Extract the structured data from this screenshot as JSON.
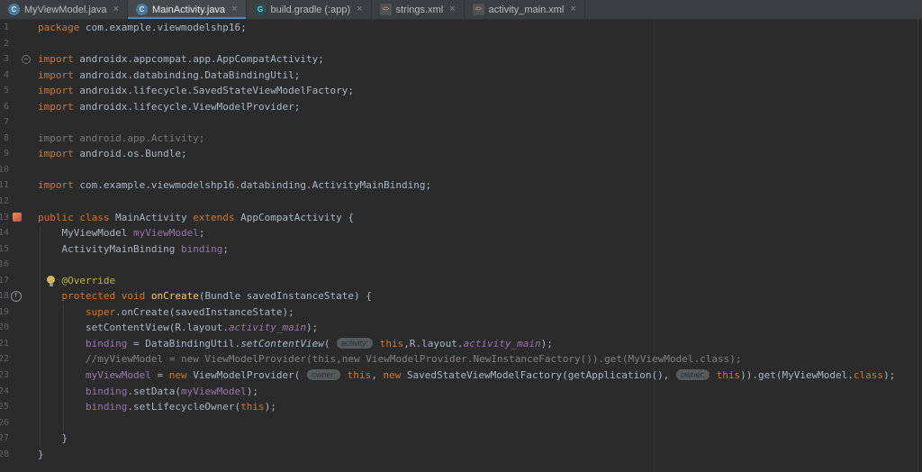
{
  "colors": {
    "editor_bg": "#2b2b2b",
    "tab_bar_bg": "#3c3f41",
    "active_tab_underline": "#4a88c7",
    "keyword": "#cc7832",
    "text": "#a9b7c6",
    "field": "#9876aa",
    "method_decl": "#ffc66b",
    "annotation": "#bbb529",
    "comment": "#808080",
    "line_number": "#606366",
    "hint_bg": "#555a5c",
    "hint_text": "#2d3133"
  },
  "icons": {
    "java-class": "C",
    "gradle": "G",
    "xml": "<>"
  },
  "tab_bar": {
    "close_glyph": "×",
    "tabs": [
      {
        "label": "MyViewModel.java",
        "icon": "java-class",
        "active": false
      },
      {
        "label": "MainActivity.java",
        "icon": "java-class",
        "active": true
      },
      {
        "label": "build.gradle (:app)",
        "icon": "gradle",
        "active": false
      },
      {
        "label": "strings.xml",
        "icon": "xml",
        "active": false
      },
      {
        "label": "activity_main.xml",
        "icon": "xml",
        "active": false
      }
    ]
  },
  "editor": {
    "lines": [
      {
        "n": 1,
        "tokens": [
          [
            "kw",
            "package "
          ],
          [
            "txt",
            "com.example.viewmodelshp16;"
          ]
        ]
      },
      {
        "n": 2,
        "tokens": []
      },
      {
        "n": 3,
        "gutter": "fold",
        "tokens": [
          [
            "kw",
            "import "
          ],
          [
            "txt",
            "androidx.appcompat.app.AppCompatActivity;"
          ]
        ]
      },
      {
        "n": 4,
        "tokens": [
          [
            "kw",
            "import "
          ],
          [
            "txt",
            "androidx.databinding.DataBindingUtil;"
          ]
        ]
      },
      {
        "n": 5,
        "tokens": [
          [
            "kw",
            "import "
          ],
          [
            "txt",
            "androidx.lifecycle.SavedStateViewModelFactory;"
          ]
        ]
      },
      {
        "n": 6,
        "tokens": [
          [
            "kw",
            "import "
          ],
          [
            "txt",
            "androidx.lifecycle.ViewModelProvider;"
          ]
        ]
      },
      {
        "n": 7,
        "tokens": []
      },
      {
        "n": 8,
        "tokens": [
          [
            "gray",
            "import android.app.Activity;"
          ]
        ]
      },
      {
        "n": 9,
        "tokens": [
          [
            "kw",
            "import "
          ],
          [
            "txt",
            "android.os.Bundle;"
          ]
        ]
      },
      {
        "n": 10,
        "tokens": []
      },
      {
        "n": 11,
        "tokens": [
          [
            "kw",
            "import "
          ],
          [
            "txt",
            "com.example.viewmodelshp16.databinding.ActivityMainBinding;"
          ]
        ]
      },
      {
        "n": 12,
        "tokens": []
      },
      {
        "n": 13,
        "gutter": "cls",
        "tokens": [
          [
            "kw",
            "public class "
          ],
          [
            "txt",
            "MainActivity "
          ],
          [
            "kw",
            "extends "
          ],
          [
            "txt",
            "AppCompatActivity {"
          ]
        ]
      },
      {
        "n": 14,
        "tokens": [
          [
            "txt",
            "    MyViewModel "
          ],
          [
            "field",
            "myViewModel"
          ],
          [
            "txt",
            ";"
          ]
        ]
      },
      {
        "n": 15,
        "tokens": [
          [
            "txt",
            "    ActivityMainBinding "
          ],
          [
            "field",
            "binding"
          ],
          [
            "txt",
            ";"
          ]
        ]
      },
      {
        "n": 16,
        "tokens": []
      },
      {
        "n": 17,
        "bulb": true,
        "tokens": [
          [
            "txt",
            "    "
          ],
          [
            "anno",
            "@Override"
          ]
        ]
      },
      {
        "n": 18,
        "gutter": "override",
        "tokens": [
          [
            "txt",
            "    "
          ],
          [
            "kw",
            "protected void "
          ],
          [
            "method",
            "onCreate"
          ],
          [
            "txt",
            "(Bundle savedInstanceState) {"
          ]
        ]
      },
      {
        "n": 19,
        "tokens": [
          [
            "txt",
            "        "
          ],
          [
            "kw",
            "super"
          ],
          [
            "txt",
            ".onCreate(savedInstanceState);"
          ]
        ]
      },
      {
        "n": 20,
        "tokens": [
          [
            "txt",
            "        setContentView(R.layout."
          ],
          [
            "sfield",
            "activity_main"
          ],
          [
            "txt",
            ");"
          ]
        ]
      },
      {
        "n": 21,
        "tokens": [
          [
            "txt",
            "        "
          ],
          [
            "field",
            "binding"
          ],
          [
            "txt",
            " = DataBindingUtil."
          ],
          [
            "smethod",
            "setContentView"
          ],
          [
            "txt",
            "( "
          ],
          [
            "hint",
            "activity:"
          ],
          [
            "kw",
            " this"
          ],
          [
            "txt",
            ",R.layout."
          ],
          [
            "sfield",
            "activity_main"
          ],
          [
            "txt",
            ");"
          ]
        ]
      },
      {
        "n": 22,
        "tokens": [
          [
            "comment",
            "        //myViewModel = new ViewModelProvider(this,new ViewModelProvider.NewInstanceFactory()).get(MyViewModel.class);"
          ]
        ]
      },
      {
        "n": 23,
        "tokens": [
          [
            "txt",
            "        "
          ],
          [
            "field",
            "myViewModel"
          ],
          [
            "txt",
            " = "
          ],
          [
            "kw",
            "new"
          ],
          [
            "txt",
            " ViewModelProvider( "
          ],
          [
            "hint",
            "owner:"
          ],
          [
            "kw",
            " this"
          ],
          [
            "txt",
            ", "
          ],
          [
            "kw",
            "new"
          ],
          [
            "txt",
            " SavedStateViewModelFactory(getApplication(), "
          ],
          [
            "hint",
            "owner:"
          ],
          [
            "kw",
            " this"
          ],
          [
            "txt",
            ")).get(MyViewModel."
          ],
          [
            "kw",
            "class"
          ],
          [
            "txt",
            ");"
          ]
        ]
      },
      {
        "n": 24,
        "tokens": [
          [
            "txt",
            "        "
          ],
          [
            "field",
            "binding"
          ],
          [
            "txt",
            ".setData("
          ],
          [
            "field",
            "myViewModel"
          ],
          [
            "txt",
            ");"
          ]
        ]
      },
      {
        "n": 25,
        "tokens": [
          [
            "txt",
            "        "
          ],
          [
            "field",
            "binding"
          ],
          [
            "txt",
            ".setLifecycleOwner("
          ],
          [
            "kw",
            "this"
          ],
          [
            "txt",
            ");"
          ]
        ]
      },
      {
        "n": 26,
        "tokens": []
      },
      {
        "n": 27,
        "tokens": [
          [
            "txt",
            "    }"
          ]
        ]
      },
      {
        "n": 28,
        "tokens": [
          [
            "txt",
            "}"
          ]
        ]
      }
    ]
  }
}
